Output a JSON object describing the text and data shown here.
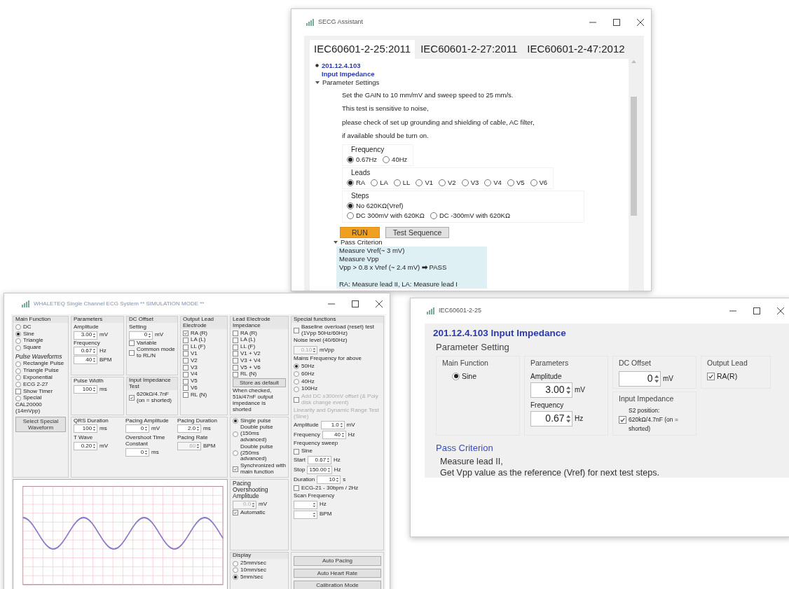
{
  "top_window": {
    "title": "SECG Assistant",
    "tabs": [
      {
        "label": "IEC60601-2-25:2011",
        "selected": true
      },
      {
        "label": "IEC60601-2-27:2011",
        "selected": false
      },
      {
        "label": "IEC60601-2-47:2012",
        "selected": false
      }
    ],
    "clause": {
      "number": "201.12.4.103",
      "name": "Input Impedance"
    },
    "parameter_settings": {
      "title": "Parameter Settings",
      "expanded": true,
      "notes": [
        "Set the GAIN to 10 mm/mV and sweep speed to 25 mm/s.",
        "This test is sensitive to noise,",
        "please check of set up grounding and shielding of cable, AC filter,",
        "if available should be turn on."
      ],
      "groups": [
        {
          "title": "Frequency",
          "items": [
            {
              "kind": "radio",
              "label": "0.67Hz",
              "selected": true
            },
            {
              "kind": "radio",
              "label": "40Hz",
              "selected": false
            }
          ]
        },
        {
          "title": "Leads",
          "items": [
            {
              "kind": "radio",
              "label": "RA",
              "selected": true
            },
            {
              "kind": "radio",
              "label": "LA",
              "selected": false
            },
            {
              "kind": "radio",
              "label": "LL",
              "selected": false
            },
            {
              "kind": "radio",
              "label": "V1",
              "selected": false
            },
            {
              "kind": "radio",
              "label": "V2",
              "selected": false
            },
            {
              "kind": "radio",
              "label": "V3",
              "selected": false
            },
            {
              "kind": "radio",
              "label": "V4",
              "selected": false
            },
            {
              "kind": "radio",
              "label": "V5",
              "selected": false
            },
            {
              "kind": "radio",
              "label": "V6",
              "selected": false
            }
          ]
        },
        {
          "title": "Steps",
          "items": [
            {
              "kind": "radio",
              "label": "No 620KΩ(Vref)",
              "selected": true
            },
            {
              "kind": "radio",
              "label": "DC 300mV with 620KΩ",
              "selected": false
            },
            {
              "kind": "radio",
              "label": "DC -300mV with 620KΩ",
              "selected": false
            }
          ]
        }
      ]
    },
    "buttons": [
      {
        "label": "RUN",
        "kind": "primary"
      },
      {
        "label": "Test Sequence",
        "kind": "secondary"
      }
    ],
    "pass_criterion": {
      "title": "Pass Criterion",
      "expanded": true,
      "paragraphs": [
        [
          "Measure Vref(~ 3 mV)",
          "Measure Vpp",
          "Vpp > 0.8 x Vref (~ 2.4 mV) **➡** PASS"
        ],
        [
          "RA: Measure lead II,  LA: Measure lead I"
        ]
      ]
    }
  },
  "ecg_window": {
    "title": "WHALETEQ Single Channel ECG System   ** SIMULATION MODE **",
    "groups": [
      {
        "title": "Main Function",
        "items": [
          {
            "kind": "radio",
            "label": "DC",
            "selected": false
          },
          {
            "kind": "radio",
            "label": "Sine",
            "selected": true
          },
          {
            "kind": "radio",
            "label": "Triangle",
            "selected": false
          },
          {
            "kind": "radio",
            "label": "Square",
            "selected": false
          },
          {
            "kind": "heading",
            "text": "Pulse Waveforms"
          },
          {
            "kind": "radio",
            "label": "Rectangle Pulse",
            "selected": false
          },
          {
            "kind": "radio",
            "label": "Triangle Pulse",
            "selected": false
          },
          {
            "kind": "radio",
            "label": "Exponential",
            "selected": false
          },
          {
            "kind": "radio",
            "label": "ECG 2-27",
            "selected": false
          },
          {
            "kind": "check",
            "label": "Show Timer",
            "checked": false
          },
          {
            "kind": "radio",
            "label": "Special",
            "selected": false
          },
          {
            "kind": "label",
            "text": "CAL20000 (14mVpp)"
          },
          {
            "kind": "button",
            "label": "Select Special Waveform"
          }
        ]
      },
      {
        "title": "Parameters",
        "items": [
          {
            "kind": "field",
            "caption": "Amplitude",
            "value": "3.00",
            "unit": "mV"
          },
          {
            "kind": "field",
            "caption": "Frequency",
            "value": "0.67",
            "unit": "Hz"
          },
          {
            "kind": "field",
            "value": "40",
            "unit": "BPM"
          }
        ]
      },
      {
        "title": "DC Offset",
        "items": [
          {
            "kind": "field",
            "caption": "Setting",
            "value": "0",
            "unit": "mV"
          },
          {
            "kind": "check",
            "label": "Variable",
            "checked": false
          },
          {
            "kind": "check",
            "label": "Common mode to RL/N",
            "checked": false
          }
        ]
      },
      {
        "items": [
          {
            "kind": "field",
            "caption": "Pulse Width",
            "value": "100",
            "unit": "ms"
          }
        ]
      },
      {
        "title": "Input Impedance Test",
        "items": [
          {
            "kind": "check",
            "label": "620kΩ/4.7nF (on = shorted)",
            "checked": true
          }
        ]
      },
      {
        "title": "Output Lead Electrode",
        "items": [
          {
            "kind": "check",
            "label": "RA (R)",
            "checked": true
          },
          {
            "kind": "check",
            "label": "LA (L)",
            "checked": false
          },
          {
            "kind": "check",
            "label": "LL (F)",
            "checked": false
          },
          {
            "kind": "check",
            "label": "V1",
            "checked": false
          },
          {
            "kind": "check",
            "label": "V2",
            "checked": false
          },
          {
            "kind": "check",
            "label": "V3",
            "checked": false
          },
          {
            "kind": "check",
            "label": "V4",
            "checked": false
          },
          {
            "kind": "check",
            "label": "V5",
            "checked": false
          },
          {
            "kind": "check",
            "label": "V6",
            "checked": false
          },
          {
            "kind": "check",
            "label": "RL (N)",
            "checked": false
          }
        ]
      },
      {
        "title": "Lead Electrode Impedance",
        "items": [
          {
            "kind": "check",
            "label": "RA (R)",
            "checked": false
          },
          {
            "kind": "check",
            "label": "LA (L)",
            "checked": false
          },
          {
            "kind": "check",
            "label": "LL (F)",
            "checked": false
          },
          {
            "kind": "check",
            "label": "V1 + V2",
            "checked": false
          },
          {
            "kind": "check",
            "label": "V3 + V4",
            "checked": false
          },
          {
            "kind": "check",
            "label": "V5 + V6",
            "checked": false
          },
          {
            "kind": "check",
            "label": "RL (N)",
            "checked": false
          },
          {
            "kind": "button",
            "label": "Store as default"
          },
          {
            "kind": "label",
            "text": "When checked, 51k/47nF output impedance is shorted"
          }
        ]
      },
      {
        "items": [
          {
            "kind": "field",
            "caption": "QRS Duration",
            "value": "100",
            "unit": "ms"
          },
          {
            "kind": "field",
            "caption": "Pacing Amplitude",
            "value": "0",
            "unit": "mV"
          },
          {
            "kind": "field",
            "caption": "Pacing Duration",
            "value": "2.0",
            "unit": "ms"
          },
          {
            "kind": "field",
            "caption": "T Wave",
            "value": "0.20",
            "unit": "mV"
          },
          {
            "kind": "field",
            "caption": "Overshoot Time Constant",
            "value": "0",
            "unit": "ms"
          },
          {
            "kind": "field",
            "caption": "Pacing Rate",
            "value": "60",
            "unit": "BPM",
            "disabled": true
          }
        ]
      },
      {
        "items": [
          {
            "kind": "radio",
            "label": "Single pulse",
            "selected": true
          },
          {
            "kind": "radio",
            "label": "Double pulse (150ms advanced)",
            "selected": false
          },
          {
            "kind": "radio",
            "label": "Double pulse (250ms advanced)",
            "selected": false
          },
          {
            "kind": "check",
            "label": "Synchronized with main function",
            "checked": true
          }
        ]
      },
      {
        "kind": "chart"
      },
      {
        "items": [
          {
            "kind": "label",
            "text": "Pacing Overshooting Amplitude"
          },
          {
            "kind": "field",
            "value": "0.0",
            "unit": "mV",
            "disabled": true
          },
          {
            "kind": "check",
            "label": "Automatic",
            "checked": true
          }
        ]
      },
      {
        "title": "Display",
        "items": [
          {
            "kind": "radio",
            "label": "25mm/sec",
            "selected": false
          },
          {
            "kind": "radio",
            "label": "10mm/sec",
            "selected": false
          },
          {
            "kind": "radio",
            "label": "5mm/sec",
            "selected": true
          }
        ]
      },
      {
        "title": "Special functions",
        "items": [
          {
            "kind": "check",
            "label": "Baseline overload (reset) test (1Vpp 50Hz/60Hz)",
            "checked": false
          },
          {
            "kind": "field",
            "caption": "Noise level (40/60Hz)",
            "value": "0.10",
            "unit": "mVpp",
            "disabled": true
          },
          {
            "kind": "label",
            "text": "Mains Frequency for above"
          },
          {
            "kind": "radio",
            "label": "50Hz",
            "selected": true
          },
          {
            "kind": "radio",
            "label": "60Hz",
            "selected": false
          },
          {
            "kind": "radio",
            "label": "40Hz",
            "selected": false
          },
          {
            "kind": "radio",
            "label": "100Hz",
            "selected": false
          },
          {
            "kind": "check",
            "label": "Add DC ±300mV offset (& Poly disk change event)",
            "checked": false,
            "disabled": true
          },
          {
            "kind": "label",
            "text": "Linearity and Dynamic Range Test (Sine)",
            "disabled": true
          },
          {
            "kind": "field",
            "caption": "Amplitude",
            "value": "1.0",
            "unit": "mV"
          },
          {
            "kind": "field",
            "caption": "Frequency",
            "value": "40",
            "unit": "Hz"
          },
          {
            "kind": "label",
            "text": "Frequency sweep"
          },
          {
            "kind": "check",
            "label": "Sine",
            "checked": false
          },
          {
            "kind": "field",
            "caption": "Start",
            "value": "0.67",
            "unit": "Hz"
          },
          {
            "kind": "field",
            "caption": "Stop",
            "value": "150.00",
            "unit": "Hz"
          },
          {
            "kind": "field",
            "caption": "Duration",
            "value": "10",
            "unit": "s"
          },
          {
            "kind": "check",
            "label": "ECG-21 - 30bpm / 2Hz",
            "checked": false
          },
          {
            "kind": "label",
            "text": "Scan Frequency"
          },
          {
            "kind": "field",
            "unit": "Hz"
          },
          {
            "kind": "field",
            "unit": "BPM"
          }
        ]
      },
      {
        "items": [
          {
            "kind": "button",
            "label": "Auto Pacing"
          },
          {
            "kind": "button",
            "label": "Auto Heart Rate"
          },
          {
            "kind": "button",
            "label": "Calibration Mode"
          }
        ]
      }
    ]
  },
  "editor_window": {
    "title": "IEC60601-2-25",
    "heading": "201.12.4.103 Input Impedance",
    "section": "Parameter Setting",
    "groups": [
      {
        "title": "Main Function",
        "items": [
          {
            "kind": "radio",
            "label": "Sine",
            "selected": true
          }
        ]
      },
      {
        "title": "Parameters",
        "items": [
          {
            "kind": "field",
            "caption": "Amplitude",
            "value": "3.00",
            "unit": "mV"
          },
          {
            "kind": "field",
            "caption": "Frequency",
            "value": "0.67",
            "unit": "Hz"
          }
        ]
      },
      {
        "title": "DC Offset",
        "items": [
          {
            "kind": "field",
            "value": "0",
            "unit": "mV"
          }
        ]
      },
      {
        "title": "Output Lead",
        "items": [
          {
            "kind": "check",
            "label": "RA(R)",
            "checked": true
          }
        ]
      },
      {
        "title": "Input Impedance",
        "items": [
          {
            "kind": "check",
            "label": "S2 position: 620kΩ/4.7nF (on = shorted)",
            "checked": true
          }
        ]
      }
    ],
    "pass_title": "Pass Criterion",
    "pass_lines": [
      "Measure lead  II,",
      "Get Vpp value as the reference (Vref) for next test steps."
    ]
  }
}
